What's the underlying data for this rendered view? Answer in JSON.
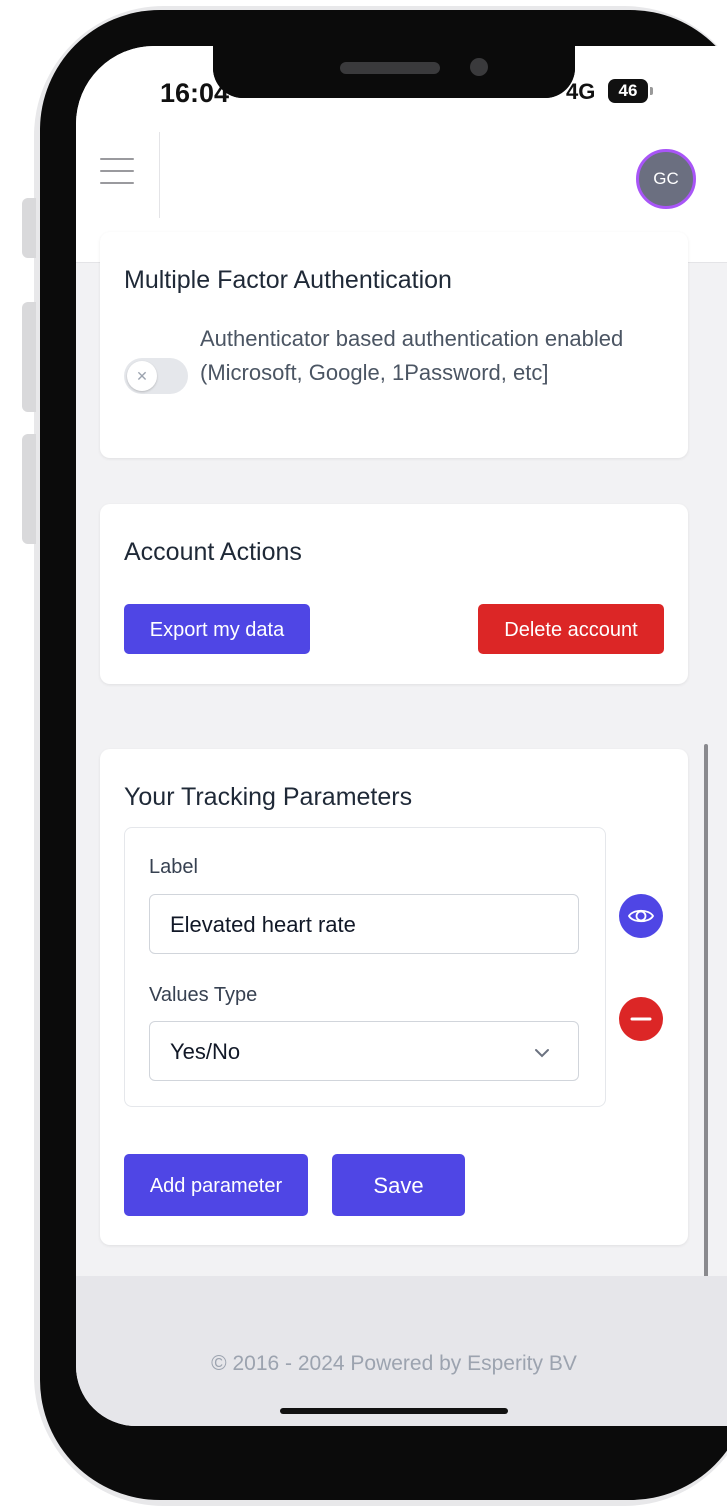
{
  "status_bar": {
    "time": "16:04",
    "network": "4G",
    "battery": "46"
  },
  "header": {
    "avatar_initials": "GC"
  },
  "mfa": {
    "title": "Multiple Factor Authentication",
    "toggle_label": "Authenticator based authentication enabled (Microsoft, Google, 1Password, etc]",
    "toggle_enabled": false
  },
  "account_actions": {
    "title": "Account Actions",
    "export_label": "Export my data",
    "delete_label": "Delete account"
  },
  "tracking": {
    "title": "Your Tracking Parameters",
    "label_field_label": "Label",
    "label_value": "Elevated heart rate",
    "values_type_label": "Values Type",
    "values_type_value": "Yes/No",
    "add_label": "Add parameter",
    "save_label": "Save"
  },
  "footer": {
    "text": "© 2016 - 2024 Powered by Esperity BV"
  },
  "colors": {
    "primary": "#4f46e5",
    "danger": "#dc2626",
    "avatar_ring": "#a855f7"
  }
}
